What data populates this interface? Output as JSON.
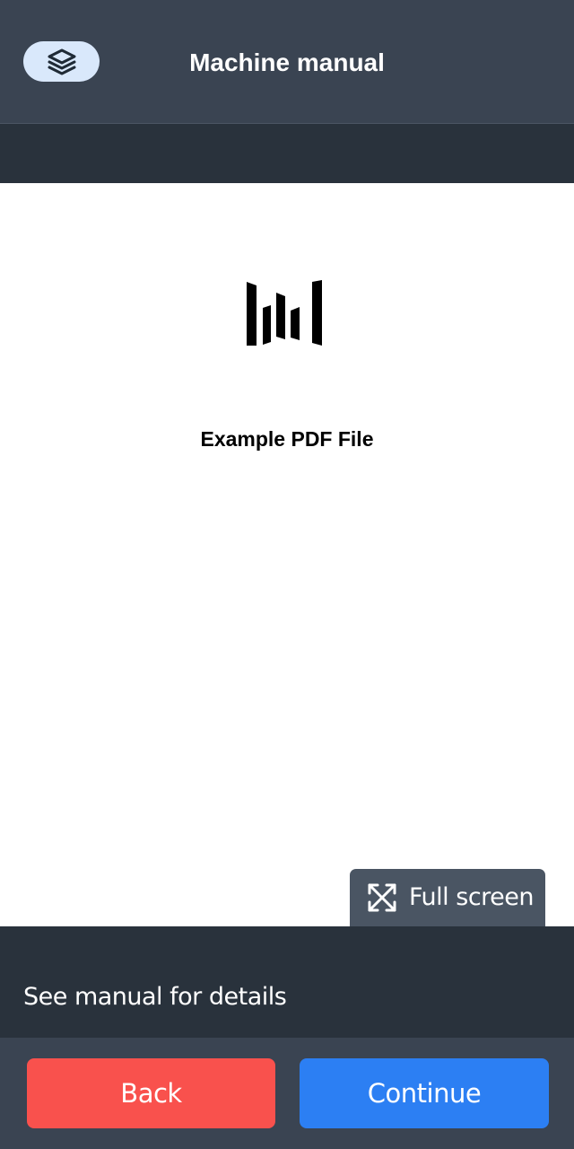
{
  "header": {
    "title": "Machine manual",
    "layers_icon": "layers-icon"
  },
  "document": {
    "logo_icon": "pdf-logo-bars",
    "title": "Example PDF File"
  },
  "viewer": {
    "fullscreen_label": "Full screen",
    "fullscreen_icon": "expand-arrows-icon"
  },
  "info": {
    "text": "See manual for details"
  },
  "footer": {
    "back_label": "Back",
    "continue_label": "Continue"
  },
  "colors": {
    "header_bg": "#3a4452",
    "dark_bar": "#29323c",
    "back_button": "#f9514d",
    "continue_button": "#2c7ff3",
    "layers_button_bg": "#d9e8fb",
    "fullscreen_button_bg": "#4a5563"
  }
}
